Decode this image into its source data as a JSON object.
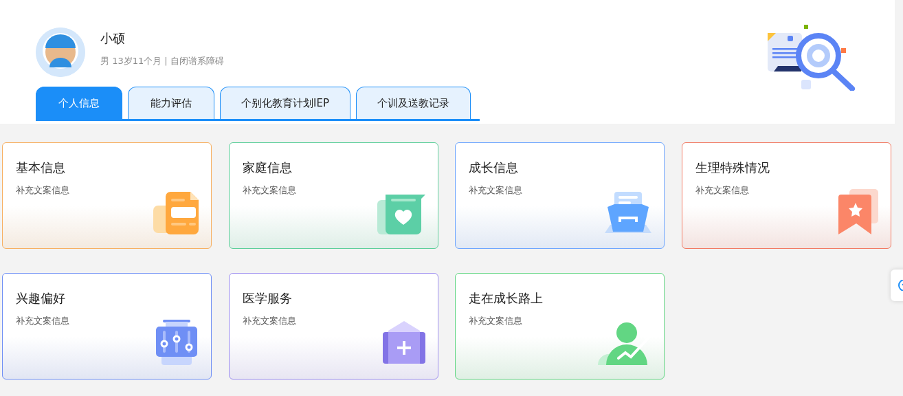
{
  "profile": {
    "name": "小硕",
    "details": "男 13岁11个月 | 自闭谱系障碍"
  },
  "tabs": [
    {
      "label": "个人信息",
      "selected": true
    },
    {
      "label": "能力评估",
      "selected": false
    },
    {
      "label": "个别化教育计划IEP",
      "selected": false
    },
    {
      "label": "个训及送教记录",
      "selected": false
    }
  ],
  "cards": [
    {
      "title": "基本信息",
      "subtitle": "补充文案信息",
      "kind": "document",
      "color": "#f7b062"
    },
    {
      "title": "家庭信息",
      "subtitle": "补充文案信息",
      "kind": "heart",
      "color": "#5ccf9a"
    },
    {
      "title": "成长信息",
      "subtitle": "补充文案信息",
      "kind": "tray",
      "color": "#6ea6ff"
    },
    {
      "title": "生理特殊情况",
      "subtitle": "补充文案信息",
      "kind": "bookmark",
      "color": "#f27a63"
    },
    {
      "title": "兴趣偏好",
      "subtitle": "补充文案信息",
      "kind": "sliders",
      "color": "#6f8ff5"
    },
    {
      "title": "医学服务",
      "subtitle": "补充文案信息",
      "kind": "medkit",
      "color": "#9d8ef0"
    },
    {
      "title": "走在成长路上",
      "subtitle": "补充文案信息",
      "kind": "person",
      "color": "#62d683"
    }
  ]
}
